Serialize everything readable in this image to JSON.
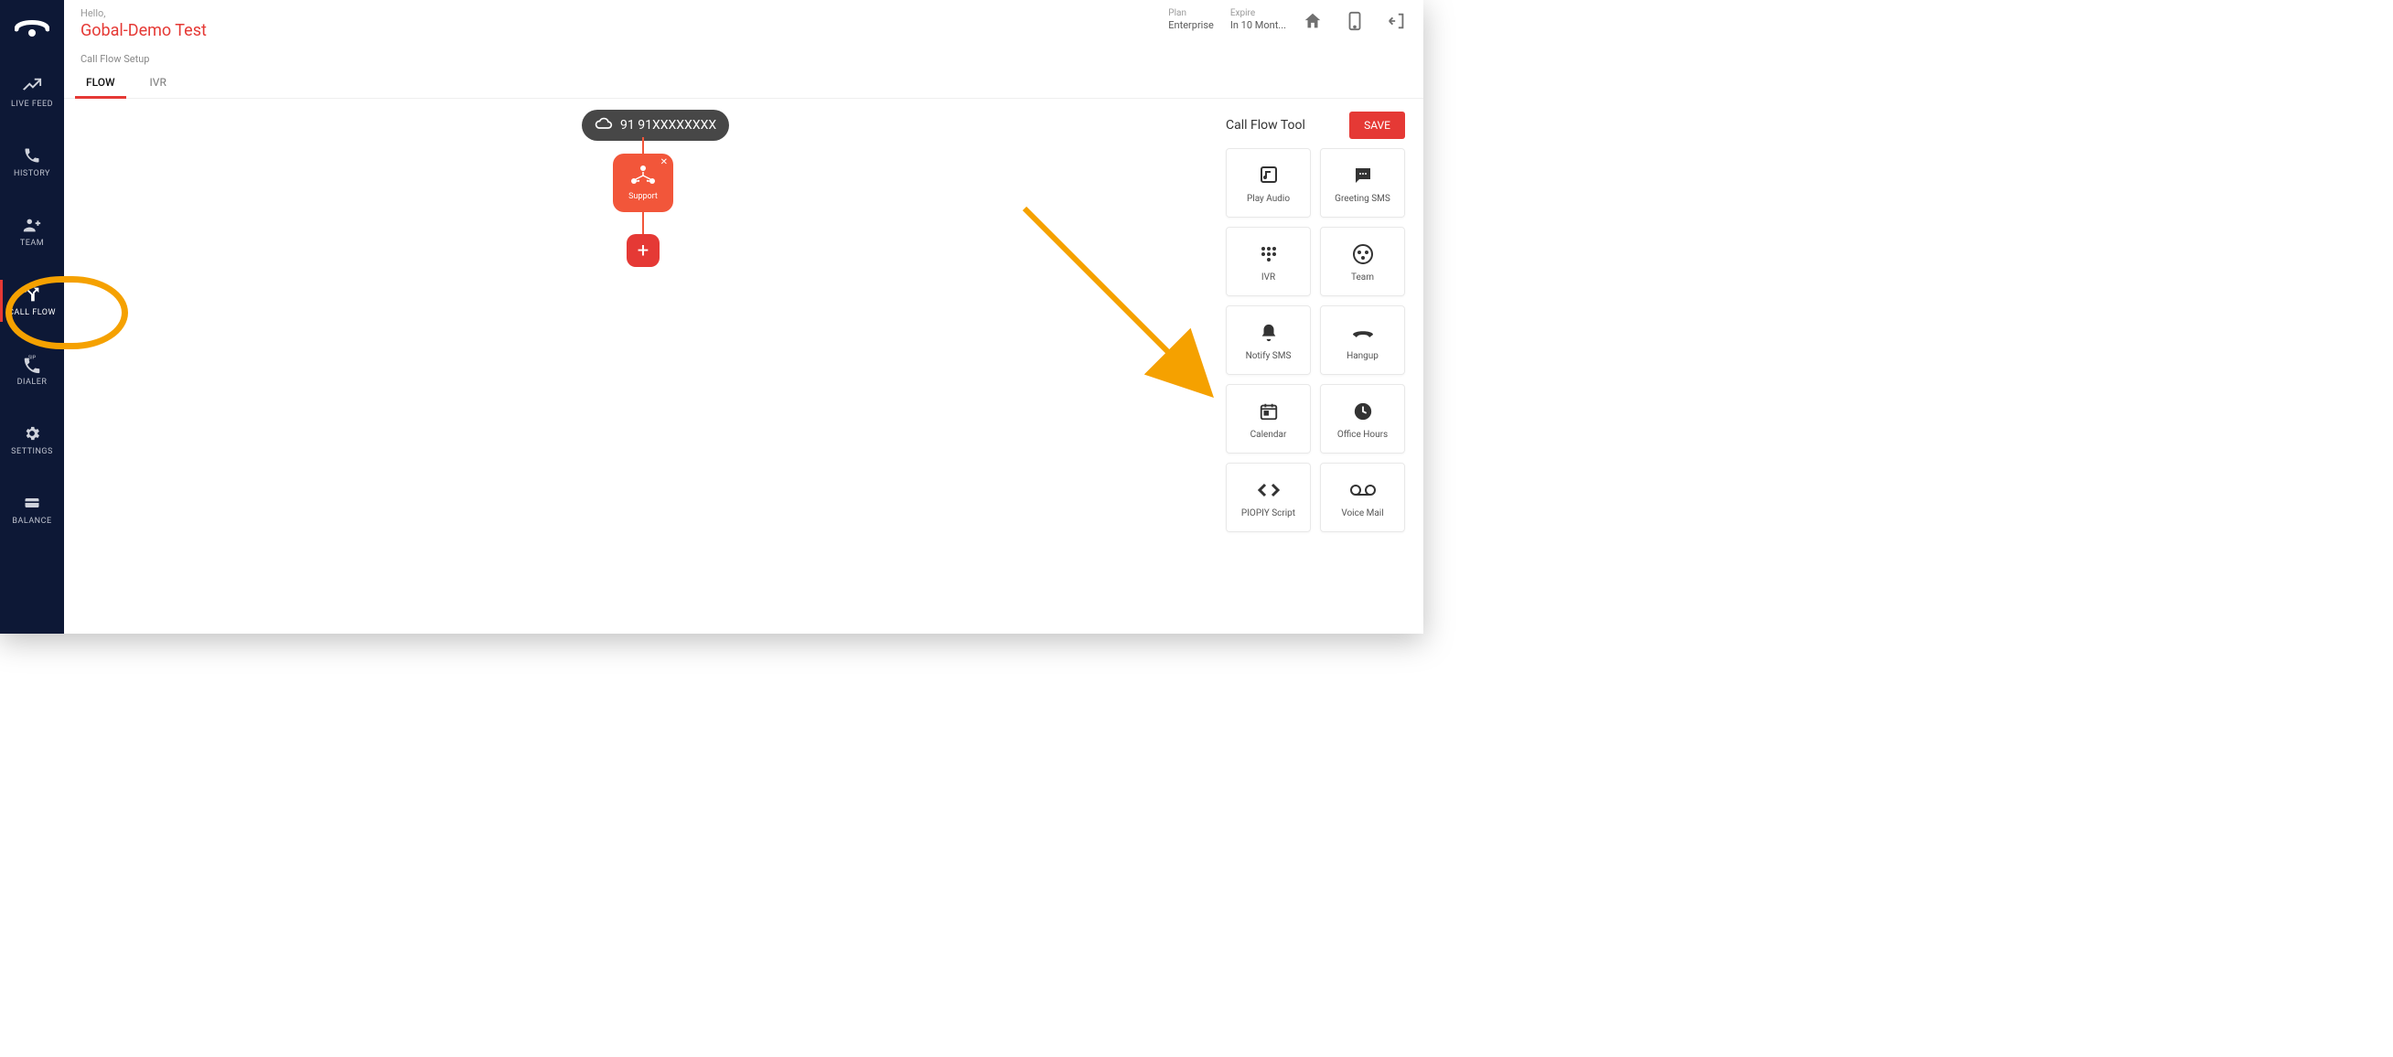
{
  "header": {
    "hello": "Hello,",
    "account_name": "Gobal-Demo Test",
    "plan_label": "Plan",
    "plan_value": "Enterprise",
    "expire_label": "Expire",
    "expire_value": "In 10 Mont..."
  },
  "section_title": "Call Flow Setup",
  "tabs": {
    "flow": "FLOW",
    "ivr": "IVR"
  },
  "sidebar": {
    "items": [
      {
        "label": "LIVE FEED"
      },
      {
        "label": "HISTORY"
      },
      {
        "label": "TEAM"
      },
      {
        "label": "CALL FLOW"
      },
      {
        "label": "DIALER"
      },
      {
        "label": "SETTINGS"
      },
      {
        "label": "BALANCE"
      }
    ]
  },
  "flow": {
    "phone_number": "91 91XXXXXXXX",
    "support_label": "Support"
  },
  "tool_panel": {
    "title": "Call Flow Tool",
    "save_label": "SAVE",
    "tools": [
      {
        "label": "Play Audio"
      },
      {
        "label": "Greeting SMS"
      },
      {
        "label": "IVR"
      },
      {
        "label": "Team"
      },
      {
        "label": "Notify SMS"
      },
      {
        "label": "Hangup"
      },
      {
        "label": "Calendar"
      },
      {
        "label": "Office Hours"
      },
      {
        "label": "PIOPIY Script"
      },
      {
        "label": "Voice Mail"
      }
    ]
  }
}
